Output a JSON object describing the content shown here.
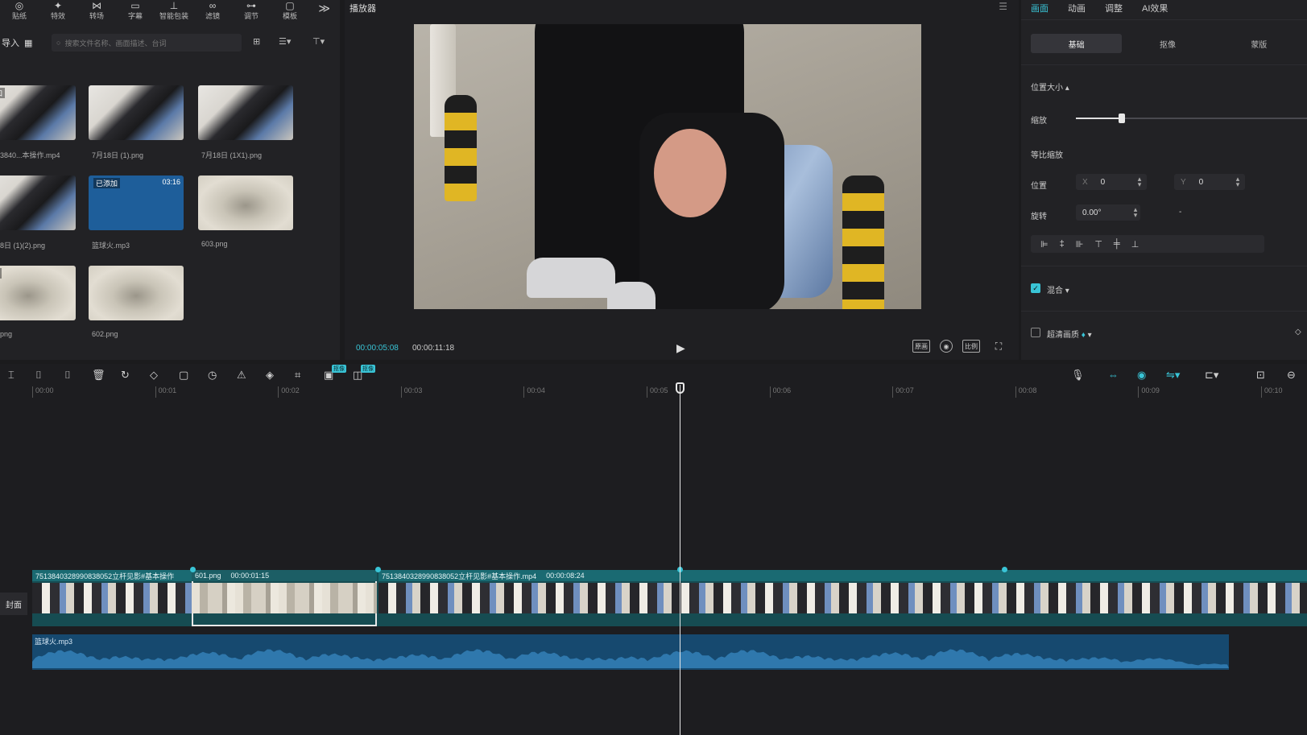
{
  "toolbar": {
    "tools": [
      {
        "label": "贴纸",
        "icon": "sticker-icon"
      },
      {
        "label": "特效",
        "icon": "effects-icon"
      },
      {
        "label": "转场",
        "icon": "transition-icon"
      },
      {
        "label": "字幕",
        "icon": "subtitle-icon"
      },
      {
        "label": "智能包装",
        "icon": "smart-pack-icon"
      },
      {
        "label": "滤镜",
        "icon": "filter-icon"
      },
      {
        "label": "调节",
        "icon": "adjust-icon"
      },
      {
        "label": "模板",
        "icon": "template-icon"
      }
    ],
    "more": "≫"
  },
  "media": {
    "import_label": "导入",
    "search_placeholder": "搜索文件名称、画面描述、台词",
    "items": [
      {
        "caption": "3840...本操作.mp4",
        "badge": "添加",
        "kind": "video"
      },
      {
        "caption": "7月18日 (1).png",
        "kind": "image"
      },
      {
        "caption": "7月18日 (1X1).png",
        "kind": "image"
      },
      {
        "caption": "8日 (1)(2).png",
        "kind": "image"
      },
      {
        "caption": "篮球火.mp3",
        "badge": "已添加",
        "duration": "03:16",
        "kind": "audio"
      },
      {
        "caption": "603.png",
        "kind": "sketch"
      },
      {
        "caption": "png",
        "badge": "添加",
        "kind": "sketch"
      },
      {
        "caption": "602.png",
        "kind": "sketch"
      }
    ]
  },
  "player": {
    "title": "播放器",
    "current_time": "00:00:05:08",
    "total_time": "00:00:11:18",
    "ctrl_icons": [
      "原画",
      "screenshot",
      "比例",
      "fullscreen"
    ]
  },
  "inspector": {
    "tabs": [
      "画面",
      "动画",
      "调整",
      "AI效果"
    ],
    "active_tab": 0,
    "segments": [
      "基础",
      "抠像",
      "蒙版"
    ],
    "section_position": "位置大小",
    "scale_label": "缩放",
    "scale_value": 0.2,
    "uniform_scale_label": "等比缩放",
    "position_label": "位置",
    "pos_x_axis": "X",
    "pos_x": "0",
    "pos_y_axis": "Y",
    "pos_y": "0",
    "rotate_label": "旋转",
    "rotate_value": "0.00°",
    "rotate_dash": "-",
    "blend_label": "混合",
    "blend_checked": true,
    "super_canvas_label": "超清画质",
    "super_canvas_checked": false
  },
  "timeline": {
    "ruler": [
      "00:00",
      "00:01",
      "00:02",
      "00:03",
      "00:04",
      "00:05",
      "00:06",
      "00:07",
      "00:08",
      "00:09",
      "00:10"
    ],
    "mini_badges": [
      "抠像",
      "抠像"
    ],
    "cover_label": "封面",
    "clips": [
      {
        "name": "7513840328990838052立杆见影#基本操作",
        "duration": "",
        "kind": "video"
      },
      {
        "name": "601.png",
        "duration": "00:00:01:15",
        "kind": "sketch"
      },
      {
        "name": "7513840328990838052立杆见影#基本操作.mp4",
        "duration": "00:00:08:24",
        "kind": "video"
      }
    ],
    "audio_clip": "篮球火.mp3"
  },
  "colors": {
    "accent": "#39c4d6",
    "video_track": "#164c52",
    "audio_track": "#16496f"
  }
}
